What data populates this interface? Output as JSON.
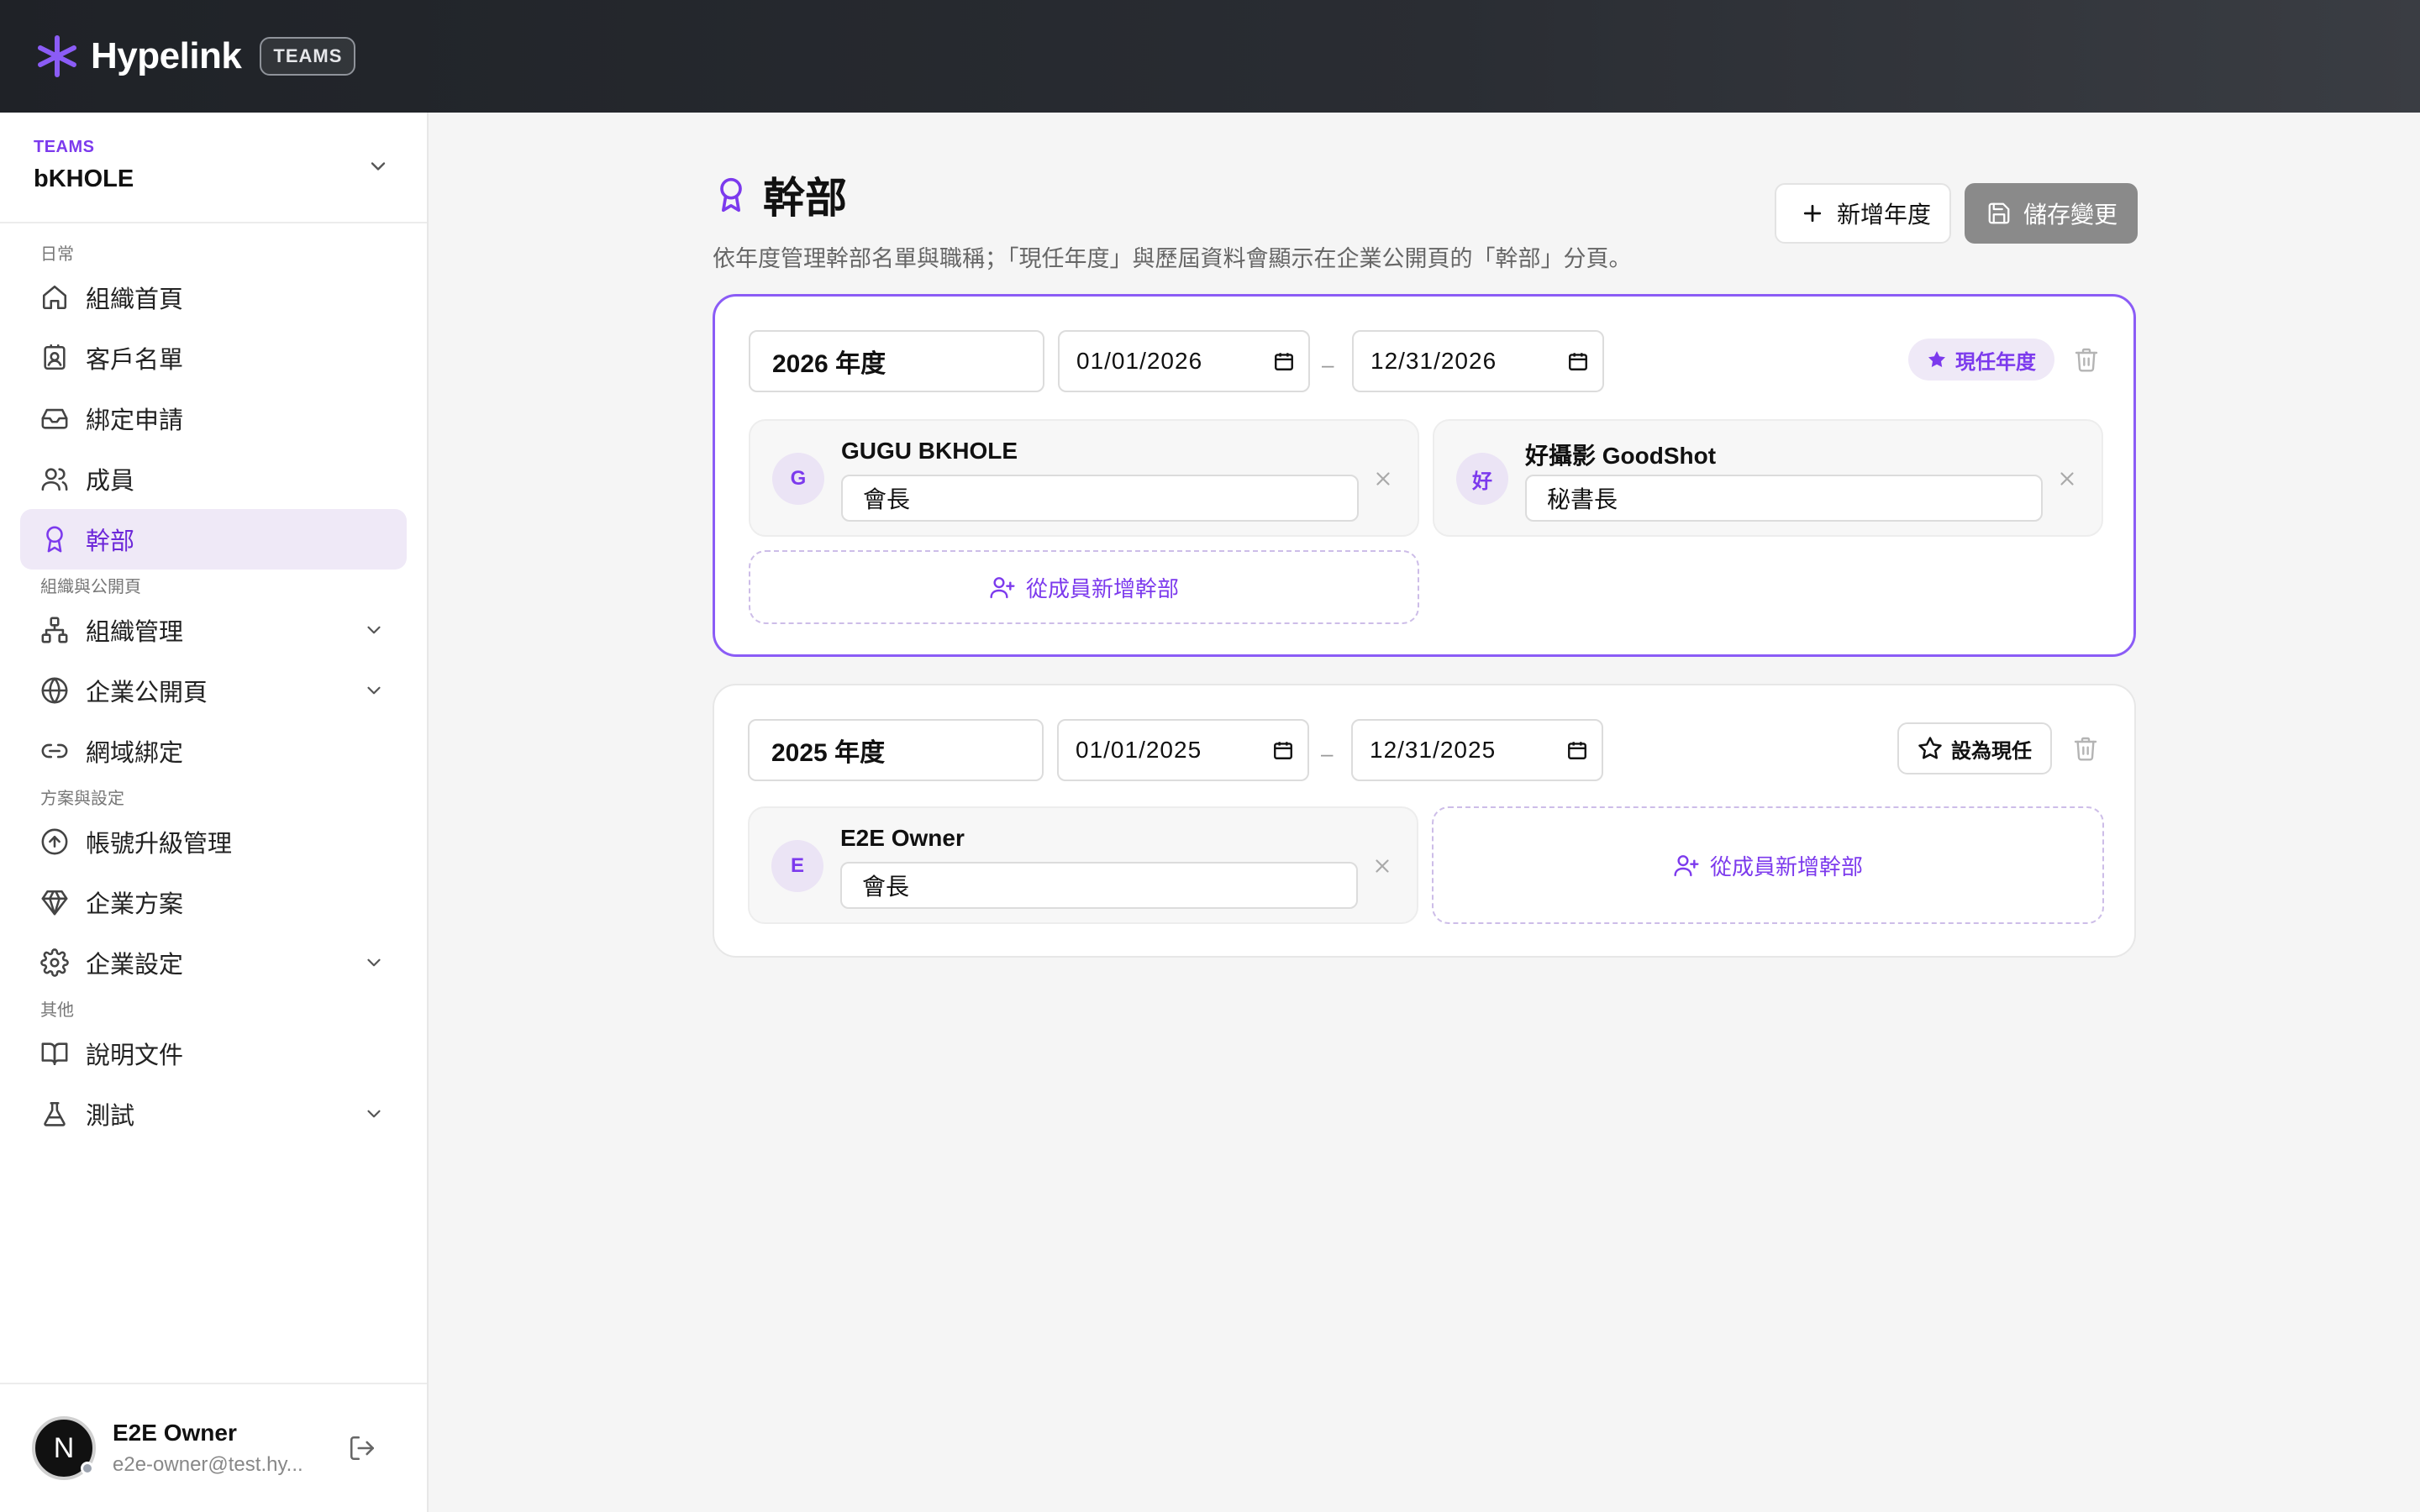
{
  "brand": {
    "name": "Hypelink",
    "pill": "TEAMS",
    "accent": "#7c3aed"
  },
  "org": {
    "kicker": "TEAMS",
    "name": "bKHOLE"
  },
  "sidebar": {
    "sections": [
      "日常",
      "組織與公開頁",
      "方案與設定",
      "其他"
    ],
    "items": [
      {
        "label": "組織首頁",
        "icon": "home-icon"
      },
      {
        "label": "客戶名單",
        "icon": "contact-icon"
      },
      {
        "label": "綁定申請",
        "icon": "inbox-icon"
      },
      {
        "label": "成員",
        "icon": "users-icon"
      },
      {
        "label": "幹部",
        "icon": "award-icon",
        "active": true
      },
      {
        "label": "組織管理",
        "icon": "org-chart-icon"
      },
      {
        "label": "企業公開頁",
        "icon": "globe-icon"
      },
      {
        "label": "網域綁定",
        "icon": "link-icon"
      },
      {
        "label": "帳號升級管理",
        "icon": "upgrade-icon"
      },
      {
        "label": "企業方案",
        "icon": "gem-icon"
      },
      {
        "label": "企業設定",
        "icon": "gear-icon"
      },
      {
        "label": "說明文件",
        "icon": "book-icon"
      },
      {
        "label": "測試",
        "icon": "flask-icon"
      }
    ]
  },
  "user": {
    "initial": "N",
    "name": "E2E Owner",
    "email": "e2e-owner@test.hy..."
  },
  "page": {
    "title": "幹部",
    "description": "依年度管理幹部名單與職稱；「現任年度」與歷屆資料會顯示在企業公開頁的「幹部」分頁。",
    "add_year_label": "新增年度",
    "save_label": "儲存變更"
  },
  "years": [
    {
      "name": "2026 年度",
      "start": "01/01/2026",
      "end": "12/31/2026",
      "current_badge": "現任年度",
      "members": [
        {
          "initial": "G",
          "name": "GUGU BKHOLE",
          "title": "會長"
        },
        {
          "initial": "好",
          "name": "好攝影 GoodShot",
          "title": "秘書長"
        }
      ],
      "add_label": "從成員新增幹部"
    },
    {
      "name": "2025 年度",
      "start": "01/01/2025",
      "end": "12/31/2025",
      "set_current_label": "設為現任",
      "members": [
        {
          "initial": "E",
          "name": "E2E Owner",
          "title": "會長"
        }
      ],
      "add_label": "從成員新增幹部"
    }
  ],
  "separator": "–"
}
